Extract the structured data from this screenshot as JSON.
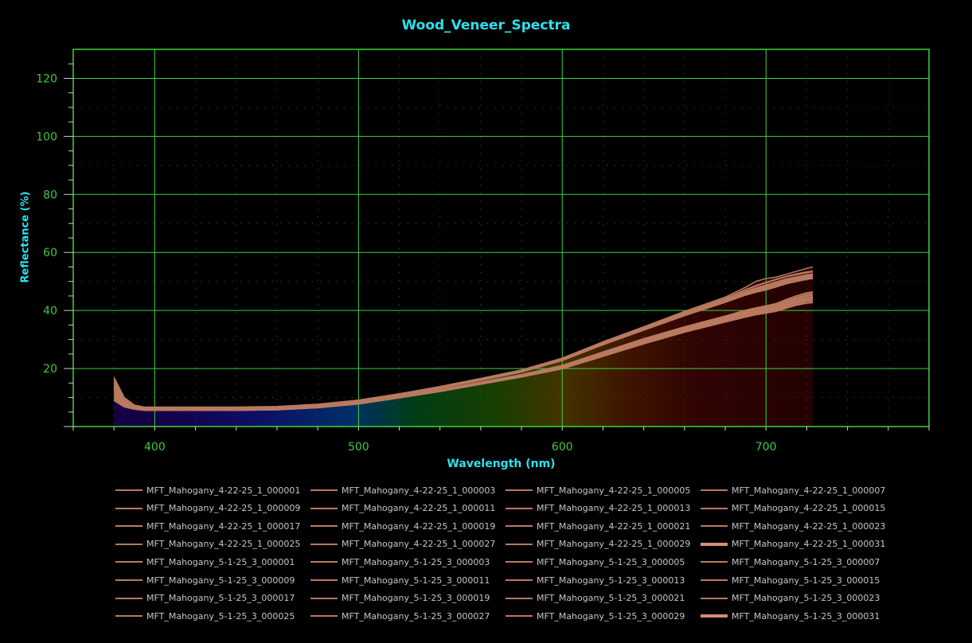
{
  "chart_data": {
    "type": "line",
    "title": "Wood_Veneer_Spectra",
    "xlabel": "Wavelength (nm)",
    "ylabel": "Reflectance (%)",
    "xlim": [
      360,
      780
    ],
    "ylim": [
      0,
      130
    ],
    "x_ticks": [
      400,
      500,
      600,
      700
    ],
    "y_ticks": [
      20,
      40,
      60,
      80,
      100,
      120
    ],
    "grid": true,
    "legend_position": "bottom",
    "colors": {
      "background": "#000000",
      "grid": "#3ed23e",
      "axis_text": "#3ec83e",
      "title": "#2ee0ee",
      "series": "#b87a60"
    },
    "spectral_fill_under_curves": true,
    "x": [
      380,
      385,
      390,
      395,
      400,
      420,
      440,
      460,
      480,
      500,
      520,
      540,
      560,
      580,
      600,
      620,
      640,
      660,
      680,
      690,
      695,
      700,
      705,
      710,
      715,
      720,
      723
    ],
    "series": [
      {
        "name": "MFT_Mahogany_4-22-25_1_000001",
        "values": [
          14,
          9,
          7,
          6.4,
          6.4,
          6.4,
          6.4,
          6.6,
          7.4,
          8.8,
          11,
          13.5,
          16.2,
          19,
          23,
          28.5,
          33.5,
          38.5,
          43,
          45.5,
          46.5,
          47.3,
          48.3,
          49.5,
          50.2,
          51,
          51.3
        ]
      },
      {
        "name": "MFT_Mahogany_4-22-25_1_000003",
        "values": [
          13,
          8.5,
          6.8,
          6.2,
          6.2,
          6.2,
          6.2,
          6.4,
          7.2,
          8.6,
          10.8,
          13.2,
          15.9,
          18.8,
          22.8,
          28.2,
          33.2,
          38.2,
          42.8,
          45.3,
          46.3,
          47.1,
          48.1,
          49.2,
          50,
          50.7,
          51
        ]
      },
      {
        "name": "MFT_Mahogany_4-22-25_1_000005",
        "values": [
          16,
          9.5,
          7.2,
          6.6,
          6.6,
          6.6,
          6.6,
          6.8,
          7.6,
          9,
          11.2,
          13.7,
          16.4,
          19.3,
          23.3,
          28.9,
          34,
          39.2,
          44,
          47,
          48.4,
          49.5,
          50.6,
          51.6,
          52.3,
          53,
          53.3
        ]
      },
      {
        "name": "MFT_Mahogany_4-22-25_1_000007",
        "values": [
          12,
          8.6,
          6.9,
          6.3,
          6.3,
          6.3,
          6.3,
          6.5,
          7.3,
          8.7,
          10.9,
          13.3,
          16,
          18.9,
          22.9,
          28.4,
          33.4,
          38.4,
          42.9,
          45.4,
          46.4,
          47.2,
          48.2,
          49.3,
          50.1,
          50.8,
          51.1
        ]
      },
      {
        "name": "MFT_Mahogany_4-22-25_1_000009",
        "values": [
          15,
          9.2,
          7.1,
          6.5,
          6.5,
          6.5,
          6.5,
          6.7,
          7.5,
          8.9,
          11.1,
          13.6,
          16.3,
          19.2,
          23.2,
          28.7,
          33.8,
          38.9,
          43.6,
          46.2,
          47.5,
          48.5,
          49.6,
          50.6,
          51.3,
          52,
          52.3
        ]
      },
      {
        "name": "MFT_Mahogany_4-22-25_1_000011",
        "values": [
          14.5,
          9,
          7,
          6.4,
          6.4,
          6.4,
          6.4,
          6.6,
          7.4,
          8.8,
          11,
          13.5,
          16.2,
          19.1,
          23.1,
          28.6,
          33.6,
          38.7,
          43.3,
          45.8,
          47,
          47.9,
          49,
          50.1,
          50.9,
          51.6,
          51.9
        ]
      },
      {
        "name": "MFT_Mahogany_4-22-25_1_000013",
        "values": [
          13.5,
          8.8,
          6.9,
          6.3,
          6.3,
          6.3,
          6.3,
          6.5,
          7.3,
          8.7,
          10.9,
          13.4,
          16.1,
          19,
          23,
          28.5,
          33.5,
          38.6,
          43.2,
          45.7,
          46.9,
          47.8,
          48.9,
          50,
          50.8,
          51.5,
          51.8
        ]
      },
      {
        "name": "MFT_Mahogany_4-22-25_1_000015",
        "values": [
          17,
          10,
          7.4,
          6.7,
          6.7,
          6.7,
          6.7,
          6.9,
          7.7,
          9.1,
          11.3,
          13.8,
          16.6,
          19.5,
          23.6,
          29.2,
          34.4,
          39.7,
          44.6,
          48,
          50,
          51,
          51.5,
          52.5,
          53.5,
          54.5,
          55
        ]
      },
      {
        "name": "MFT_Mahogany_4-22-25_1_000017",
        "values": [
          12.5,
          8.4,
          6.8,
          6.2,
          6.2,
          6.2,
          6.2,
          6.4,
          7.2,
          8.6,
          10.8,
          13.2,
          15.9,
          18.8,
          22.8,
          28.3,
          33.3,
          38.3,
          42.9,
          45.4,
          46.5,
          47.3,
          48.3,
          49.4,
          50.2,
          50.9,
          51.2
        ]
      },
      {
        "name": "MFT_Mahogany_4-22-25_1_000019",
        "values": [
          14,
          8.9,
          7,
          6.4,
          6.4,
          6.4,
          6.4,
          6.6,
          7.4,
          8.8,
          11,
          13.5,
          16.2,
          19.1,
          23.1,
          28.6,
          33.7,
          38.8,
          43.4,
          46,
          47.2,
          48.1,
          49.2,
          50.3,
          51.1,
          51.8,
          52.1
        ]
      },
      {
        "name": "MFT_Mahogany_4-22-25_1_000021",
        "values": [
          15.5,
          9.4,
          7.2,
          6.6,
          6.6,
          6.6,
          6.6,
          6.8,
          7.6,
          9,
          11.2,
          13.7,
          16.4,
          19.3,
          23.3,
          28.8,
          34,
          39.1,
          43.8,
          46.5,
          47.8,
          48.8,
          49.9,
          50.9,
          51.6,
          52.3,
          52.6
        ]
      },
      {
        "name": "MFT_Mahogany_4-22-25_1_000023",
        "values": [
          13,
          8.7,
          6.9,
          6.3,
          6.3,
          6.3,
          6.3,
          6.5,
          7.3,
          8.7,
          10.9,
          13.3,
          16,
          18.9,
          22.9,
          28.4,
          33.4,
          38.5,
          43.1,
          45.6,
          46.8,
          47.7,
          48.7,
          49.8,
          50.6,
          51.3,
          51.6
        ]
      },
      {
        "name": "MFT_Mahogany_4-22-25_1_000025",
        "values": [
          14,
          9,
          7,
          6.4,
          6.4,
          6.4,
          6.4,
          6.6,
          7.4,
          8.8,
          11,
          13.5,
          16.2,
          19.1,
          23.1,
          28.6,
          33.6,
          38.7,
          43.3,
          45.9,
          47.1,
          48,
          49.1,
          50.2,
          51,
          51.7,
          52
        ]
      },
      {
        "name": "MFT_Mahogany_4-22-25_1_000027",
        "values": [
          16.5,
          9.7,
          7.3,
          6.6,
          6.6,
          6.6,
          6.6,
          6.8,
          7.6,
          9,
          11.2,
          13.7,
          16.5,
          19.4,
          23.4,
          29,
          34.2,
          39.4,
          44.2,
          47.2,
          48.6,
          49.7,
          50.8,
          51.8,
          52.6,
          53.3,
          53.6
        ]
      },
      {
        "name": "MFT_Mahogany_4-22-25_1_000029",
        "values": [
          12,
          8.3,
          6.7,
          6.2,
          6.2,
          6.2,
          6.2,
          6.4,
          7.2,
          8.6,
          10.8,
          13.2,
          15.9,
          18.8,
          22.8,
          28.3,
          33.3,
          38.3,
          42.8,
          45.3,
          46.4,
          47.2,
          48.2,
          49.3,
          50.1,
          50.8,
          51.1
        ]
      },
      {
        "name": "MFT_Mahogany_4-22-25_1_000031",
        "values": [
          15,
          9.3,
          7.1,
          6.5,
          6.5,
          6.5,
          6.5,
          6.7,
          7.5,
          8.9,
          11.1,
          13.6,
          16.3,
          19.2,
          23.2,
          28.7,
          33.8,
          38.9,
          43.6,
          46.3,
          47.6,
          48.6,
          49.7,
          50.7,
          51.4,
          52.1,
          52.4
        ]
      },
      {
        "name": "MFT_Mahogany_5-1-25_3_000001",
        "values": [
          11,
          7.5,
          6.3,
          5.8,
          5.8,
          5.8,
          5.8,
          6,
          6.8,
          8.1,
          10.2,
          12.5,
          15,
          17.5,
          20.5,
          25,
          29.5,
          33.5,
          37,
          38.8,
          39.6,
          40.2,
          40.8,
          42,
          43,
          43.8,
          44
        ]
      },
      {
        "name": "MFT_Mahogany_5-1-25_3_000003",
        "values": [
          10,
          7,
          6.1,
          5.7,
          5.7,
          5.7,
          5.7,
          5.9,
          6.6,
          7.9,
          10,
          12.3,
          14.8,
          17.3,
          20.2,
          24.6,
          29,
          33,
          36.5,
          38.2,
          39,
          39.6,
          40.2,
          41.4,
          42.4,
          43.2,
          43.4
        ]
      },
      {
        "name": "MFT_Mahogany_5-1-25_3_000005",
        "values": [
          12,
          7.8,
          6.4,
          5.9,
          5.9,
          5.9,
          5.9,
          6.1,
          6.9,
          8.2,
          10.3,
          12.6,
          15.1,
          17.7,
          20.8,
          25.4,
          30,
          34,
          37.6,
          39.5,
          40.3,
          41,
          41.7,
          43,
          44.2,
          45.2,
          45.5
        ]
      },
      {
        "name": "MFT_Mahogany_5-1-25_3_000007",
        "values": [
          9,
          6.8,
          6,
          5.6,
          5.6,
          5.6,
          5.6,
          5.8,
          6.5,
          7.8,
          9.9,
          12.1,
          14.6,
          17.1,
          19.9,
          24.2,
          28.5,
          32.5,
          36,
          37.7,
          38.5,
          39.1,
          39.7,
          40.8,
          41.8,
          42.5,
          42.7
        ]
      },
      {
        "name": "MFT_Mahogany_5-1-25_3_000009",
        "values": [
          11.5,
          7.6,
          6.3,
          5.8,
          5.8,
          5.8,
          5.8,
          6,
          6.8,
          8.1,
          10.2,
          12.5,
          15,
          17.6,
          20.6,
          25.1,
          29.6,
          33.7,
          37.2,
          39,
          39.8,
          40.4,
          41.1,
          42.3,
          43.4,
          44.2,
          44.5
        ]
      },
      {
        "name": "MFT_Mahogany_5-1-25_3_000011",
        "values": [
          13,
          8,
          6.5,
          6,
          6,
          6,
          6,
          6.2,
          7,
          8.3,
          10.4,
          12.7,
          15.2,
          17.8,
          21,
          25.6,
          30.2,
          34.3,
          38,
          40,
          40.8,
          41.5,
          42.3,
          43.7,
          45,
          46,
          46.3
        ]
      },
      {
        "name": "MFT_Mahogany_5-1-25_3_000013",
        "values": [
          10.5,
          7.2,
          6.2,
          5.7,
          5.7,
          5.7,
          5.7,
          5.9,
          6.7,
          8,
          10.1,
          12.4,
          14.9,
          17.4,
          20.3,
          24.8,
          29.2,
          33.2,
          36.7,
          38.4,
          39.2,
          39.8,
          40.4,
          41.6,
          42.6,
          43.4,
          43.6
        ]
      },
      {
        "name": "MFT_Mahogany_5-1-25_3_000015",
        "values": [
          12.5,
          7.9,
          6.4,
          5.9,
          5.9,
          5.9,
          5.9,
          6.1,
          6.9,
          8.2,
          10.3,
          12.6,
          15.1,
          17.7,
          20.9,
          25.5,
          30.1,
          34.1,
          37.8,
          39.7,
          40.5,
          41.2,
          42,
          43.3,
          44.5,
          45.5,
          45.8
        ]
      },
      {
        "name": "MFT_Mahogany_5-1-25_3_000017",
        "values": [
          9.5,
          6.9,
          6,
          5.6,
          5.6,
          5.6,
          5.6,
          5.8,
          6.5,
          7.8,
          9.9,
          12.2,
          14.7,
          17.2,
          20,
          24.4,
          28.7,
          32.7,
          36.2,
          37.9,
          38.7,
          39.3,
          39.9,
          41,
          42,
          42.7,
          42.9
        ]
      },
      {
        "name": "MFT_Mahogany_5-1-25_3_000019",
        "values": [
          11,
          7.4,
          6.3,
          5.8,
          5.8,
          5.8,
          5.8,
          6,
          6.7,
          8,
          10.1,
          12.4,
          14.9,
          17.5,
          20.4,
          24.9,
          29.4,
          33.4,
          36.9,
          38.7,
          39.5,
          40.1,
          40.8,
          42,
          43,
          43.8,
          44.1
        ]
      },
      {
        "name": "MFT_Mahogany_5-1-25_3_000021",
        "values": [
          12,
          7.7,
          6.4,
          5.9,
          5.9,
          5.9,
          5.9,
          6.1,
          6.8,
          8.1,
          10.2,
          12.5,
          15,
          17.6,
          20.7,
          25.2,
          29.8,
          33.8,
          37.4,
          39.2,
          40,
          40.7,
          41.4,
          42.6,
          43.7,
          44.6,
          44.9
        ]
      },
      {
        "name": "MFT_Mahogany_5-1-25_3_000023",
        "values": [
          10,
          7.1,
          6.1,
          5.7,
          5.7,
          5.7,
          5.7,
          5.9,
          6.6,
          7.9,
          10,
          12.3,
          14.8,
          17.3,
          20.2,
          24.6,
          29,
          33,
          36.5,
          38.3,
          39.1,
          39.7,
          40.3,
          41.5,
          42.5,
          43.3,
          43.5
        ]
      },
      {
        "name": "MFT_Mahogany_5-1-25_3_000025",
        "values": [
          11.5,
          7.5,
          6.3,
          5.8,
          5.8,
          5.8,
          5.8,
          6,
          6.8,
          8.1,
          10.2,
          12.5,
          15,
          17.6,
          20.6,
          25.1,
          29.6,
          33.6,
          37.1,
          38.9,
          39.7,
          40.3,
          41,
          42.2,
          43.2,
          44,
          44.3
        ]
      },
      {
        "name": "MFT_Mahogany_5-1-25_3_000027",
        "values": [
          13.5,
          8.1,
          6.5,
          6,
          6,
          6,
          6,
          6.2,
          7,
          8.3,
          10.4,
          12.7,
          15.3,
          17.9,
          21.1,
          25.7,
          30.3,
          34.4,
          38.1,
          40.1,
          40.9,
          41.6,
          42.4,
          43.8,
          45.1,
          46.1,
          46.4
        ]
      },
      {
        "name": "MFT_Mahogany_5-1-25_3_000029",
        "values": [
          9,
          6.8,
          6,
          5.6,
          5.6,
          5.6,
          5.6,
          5.8,
          6.5,
          7.8,
          9.9,
          12.1,
          14.6,
          17.1,
          19.9,
          24.3,
          28.6,
          32.6,
          36.1,
          37.8,
          38.6,
          39.2,
          39.8,
          40.9,
          41.9,
          42.6,
          42.8
        ]
      },
      {
        "name": "MFT_Mahogany_5-1-25_3_000031",
        "values": [
          12,
          7.8,
          6.4,
          5.9,
          5.9,
          5.9,
          5.9,
          6.1,
          6.9,
          8.2,
          10.3,
          12.6,
          15.1,
          17.7,
          20.8,
          25.3,
          29.9,
          33.9,
          37.5,
          39.4,
          40.2,
          40.9,
          41.6,
          42.9,
          44,
          45,
          45.3
        ]
      }
    ],
    "bold_legend_entries": [
      "MFT_Mahogany_4-22-25_1_000031",
      "MFT_Mahogany_5-1-25_3_000031"
    ]
  }
}
